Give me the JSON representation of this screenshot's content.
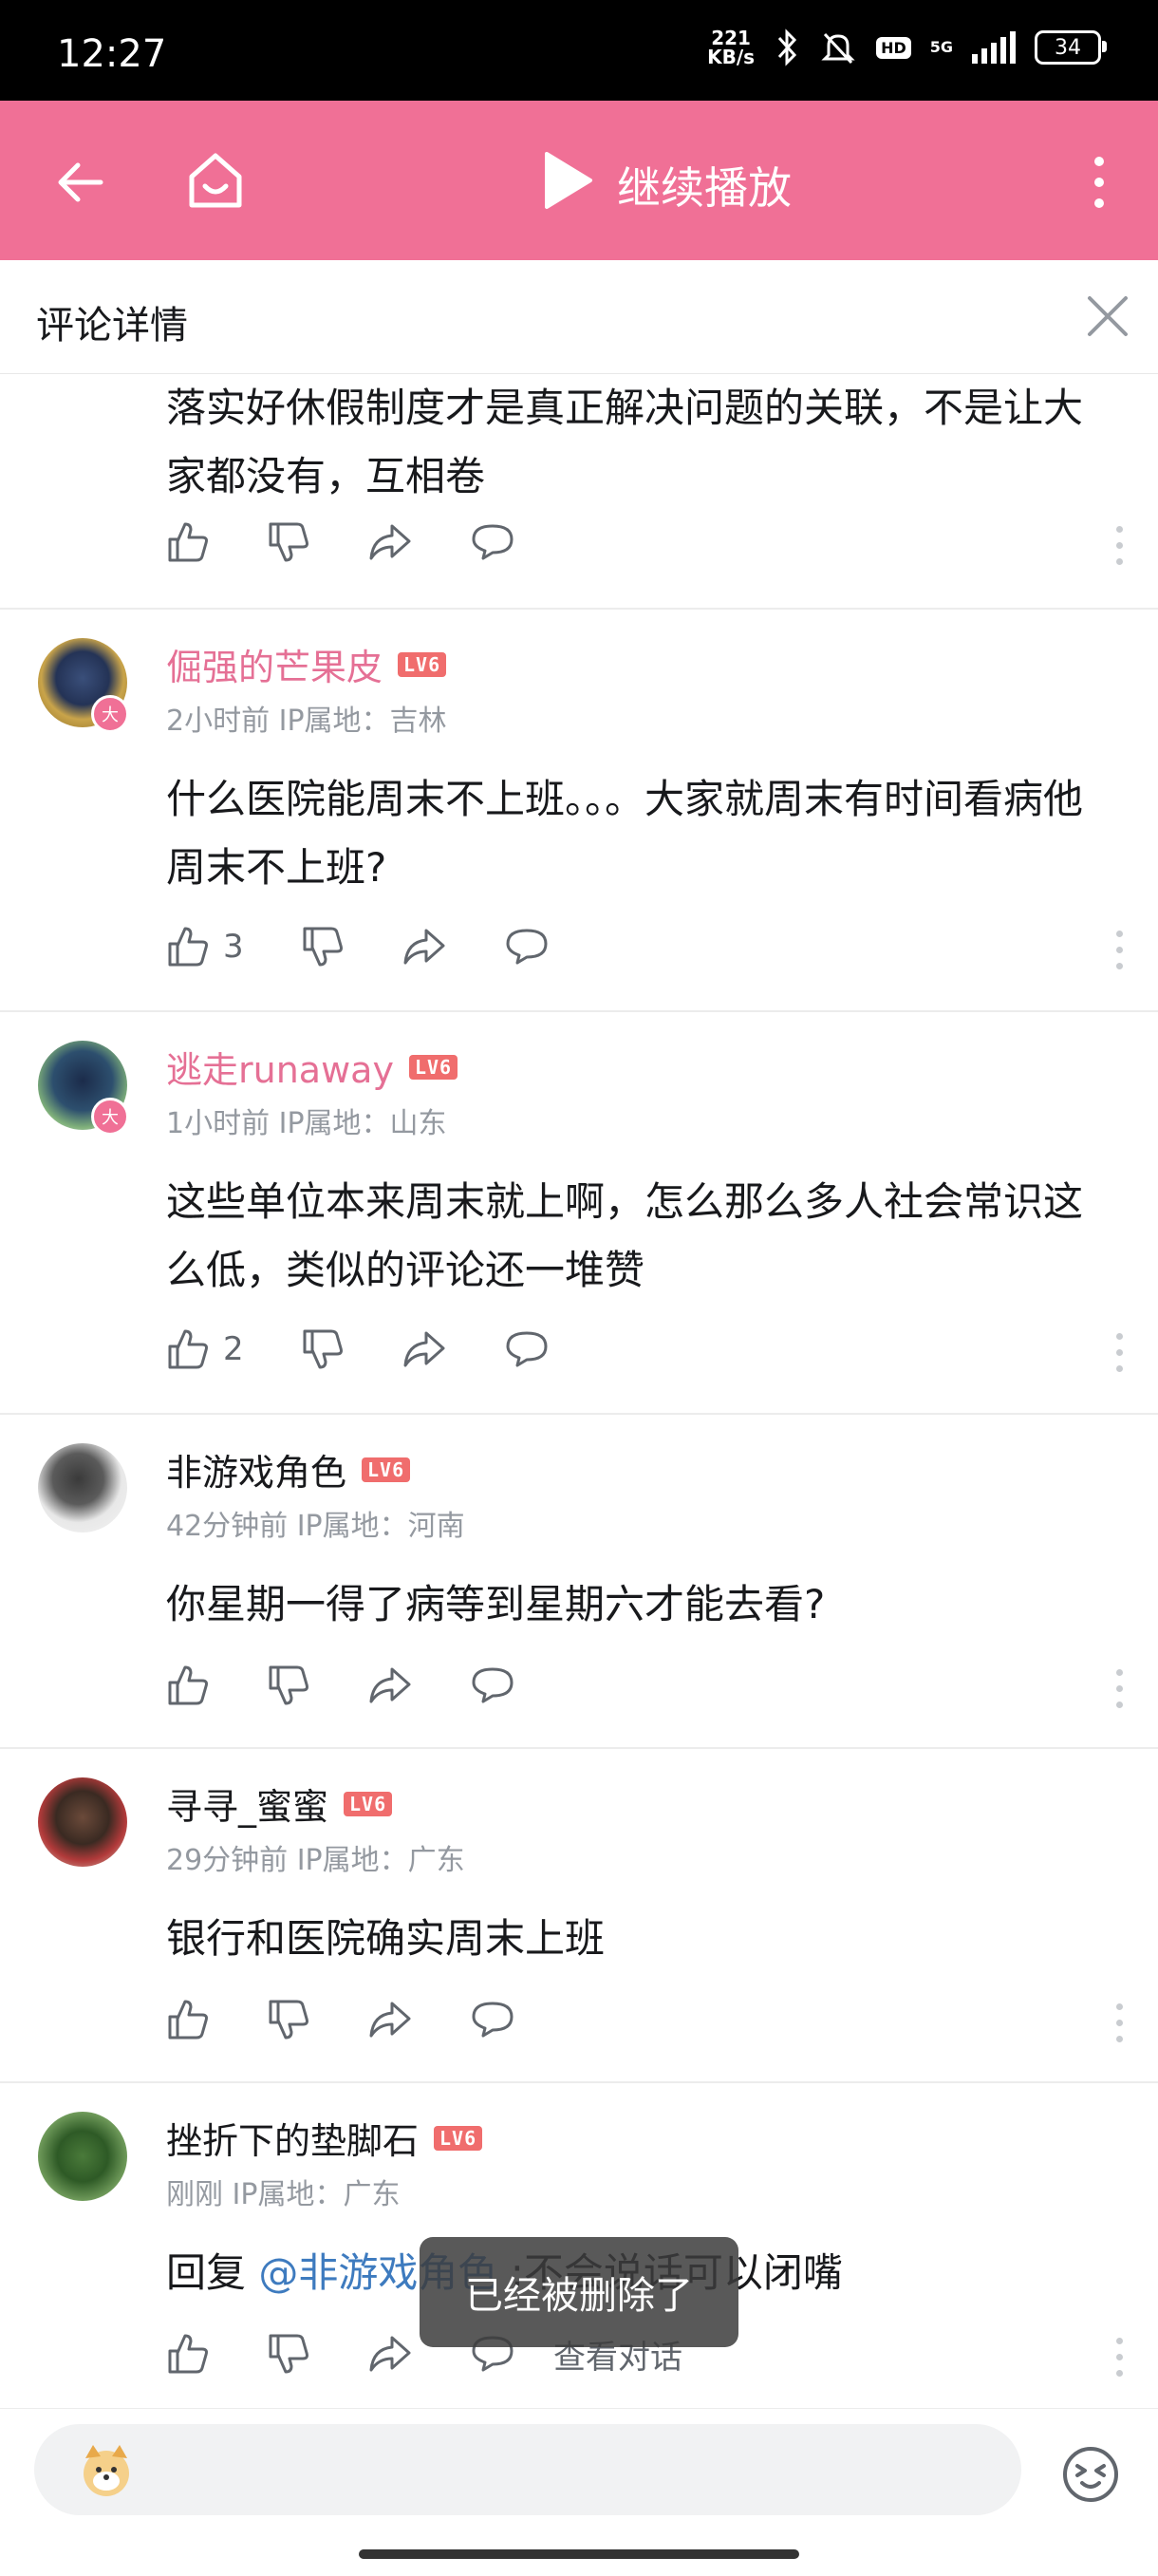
{
  "status": {
    "time": "12:27",
    "net_speed_value": "221",
    "net_speed_unit": "KB/s",
    "hd": "HD",
    "net_type": "5G",
    "battery": "34"
  },
  "topbar": {
    "continue_label": "继续播放",
    "color": "#f07096"
  },
  "panel": {
    "title": "评论详情"
  },
  "comments": [
    {
      "text": "落实好休假制度才是真正解决问题的关联，不是让大家都没有，互相卷",
      "likes": ""
    },
    {
      "username": "倔强的芒果皮",
      "level": "LV6",
      "meta": "2小时前 IP属地：吉林",
      "text": "什么医院能周末不上班。。。大家就周末有时间看病他周末不上班?",
      "likes": "3",
      "badge": "大"
    },
    {
      "username": "逃走runaway",
      "level": "LV6",
      "meta": "1小时前 IP属地：山东",
      "text": "这些单位本来周末就上啊，怎么那么多人社会常识这么低，类似的评论还一堆赞",
      "likes": "2",
      "badge": "大"
    },
    {
      "username": "非游戏角色",
      "level": "LV6",
      "meta": "42分钟前 IP属地：河南",
      "text": "你星期一得了病等到星期六才能去看?",
      "likes": ""
    },
    {
      "username": "寻寻_蜜蜜",
      "level": "LV6",
      "meta": "29分钟前 IP属地：广东",
      "text": "银行和医院确实周末上班",
      "likes": ""
    },
    {
      "username": "挫折下的垫脚石",
      "level": "LV6",
      "meta": "刚刚 IP属地：广东",
      "reply_prefix": "回复 ",
      "reply_at": "@非游戏角色",
      "text": " :不会说话可以闭嘴",
      "view_conversation": "查看对话"
    }
  ],
  "toast": "已经被删除了"
}
